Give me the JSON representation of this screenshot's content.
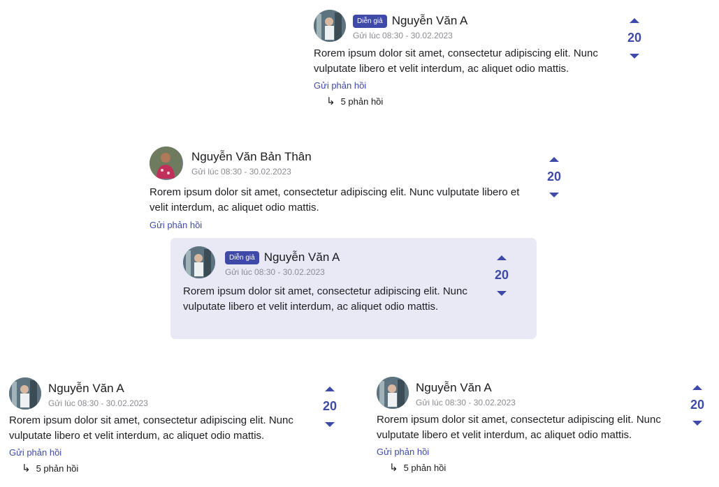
{
  "colors": {
    "accent": "#3f4aa8",
    "nested_bg": "#e8e9f5",
    "muted": "#8a8c93"
  },
  "icons": {
    "up": "caret-up-icon",
    "down": "caret-down-icon",
    "reply_arrow": "reply-arrow-icon"
  },
  "comments": [
    {
      "badge": "Diễn giả",
      "name": "Nguyễn Văn A",
      "time": "Gửi lúc 08:30 - 30.02.2023",
      "text": "Rorem ipsum dolor sit amet, consectetur adipiscing elit. Nunc vulputate libero et velit interdum, ac aliquet odio mattis.",
      "reply_label": "Gửi phản hồi",
      "replies_label": "5 phản hồi",
      "votes": "20"
    },
    {
      "name": "Nguyễn Văn Bản Thân",
      "time": "Gửi lúc 08:30 - 30.02.2023",
      "text": "Rorem ipsum dolor sit amet, consectetur adipiscing elit. Nunc vulputate libero et velit interdum, ac aliquet odio mattis.",
      "reply_label": "Gửi phản hồi",
      "votes": "20"
    },
    {
      "badge": "Diễn giả",
      "name": "Nguyễn Văn A",
      "time": "Gửi lúc 08:30 - 30.02.2023",
      "text": "Rorem ipsum dolor sit amet, consectetur adipiscing elit. Nunc vulputate libero et velit interdum, ac aliquet odio mattis.",
      "votes": "20"
    },
    {
      "name": "Nguyễn Văn A",
      "time": "Gửi lúc 08:30 - 30.02.2023",
      "text": "Rorem ipsum dolor sit amet, consectetur adipiscing elit. Nunc vulputate libero et velit interdum, ac aliquet odio mattis.",
      "reply_label": "Gửi phản hồi",
      "replies_label": "5 phản hồi",
      "votes": "20"
    },
    {
      "name": "Nguyễn Văn A",
      "time": "Gửi lúc 08:30 - 30.02.2023",
      "text": "Rorem ipsum dolor sit amet, consectetur adipiscing elit. Nunc vulputate libero et velit interdum, ac aliquet odio mattis.",
      "reply_label": "Gửi phản hồi",
      "replies_label": "5 phản hồi",
      "votes": "20"
    }
  ]
}
